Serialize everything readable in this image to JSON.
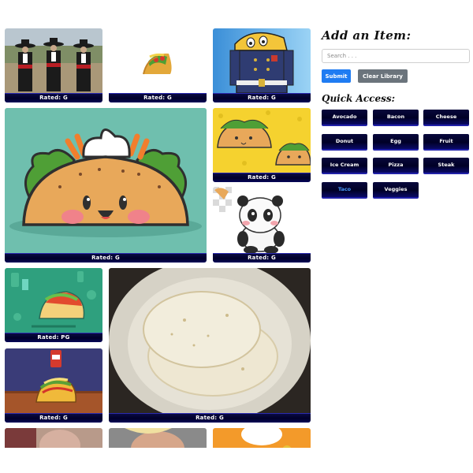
{
  "add_item": {
    "title": "Add an Item:",
    "search_placeholder": "Search . . .",
    "submit_label": "Submit",
    "clear_label": "Clear Library"
  },
  "quick_access": {
    "title": "Quick Access:",
    "items": [
      {
        "label": "Avocado",
        "active": false
      },
      {
        "label": "Bacon",
        "active": false
      },
      {
        "label": "Cheese",
        "active": false
      },
      {
        "label": "Donut",
        "active": false
      },
      {
        "label": "Egg",
        "active": false
      },
      {
        "label": "Fruit",
        "active": false
      },
      {
        "label": "Ice Cream",
        "active": false
      },
      {
        "label": "Pizza",
        "active": false
      },
      {
        "label": "Steak",
        "active": false
      },
      {
        "label": "Taco",
        "active": true
      },
      {
        "label": "Veggies",
        "active": false
      }
    ]
  },
  "gallery": {
    "cards": [
      {
        "subject": "mariachi-band",
        "rating": "Rated: G"
      },
      {
        "subject": "small-taco",
        "rating": "Rated: G"
      },
      {
        "subject": "taco-character-uniform",
        "rating": "Rated: G"
      },
      {
        "subject": "cute-taco-face",
        "rating": "Rated: G"
      },
      {
        "subject": "taco-pattern-yellow",
        "rating": "Rated: G"
      },
      {
        "subject": "panda-cartoon",
        "rating": "Rated: G"
      },
      {
        "subject": "taco-green-background",
        "rating": "Rated: PG"
      },
      {
        "subject": "tortillas-on-plate",
        "rating": "Rated: G"
      },
      {
        "subject": "taco-sauce-packet",
        "rating": "Rated: G"
      },
      {
        "subject": "partial-photo-left",
        "rating": ""
      },
      {
        "subject": "partial-photo-middle",
        "rating": ""
      },
      {
        "subject": "partial-photo-right",
        "rating": ""
      }
    ]
  },
  "colors": {
    "accent": "#1f7cf2",
    "clear_button": "#6b747c",
    "label_bar": "#00002a"
  }
}
